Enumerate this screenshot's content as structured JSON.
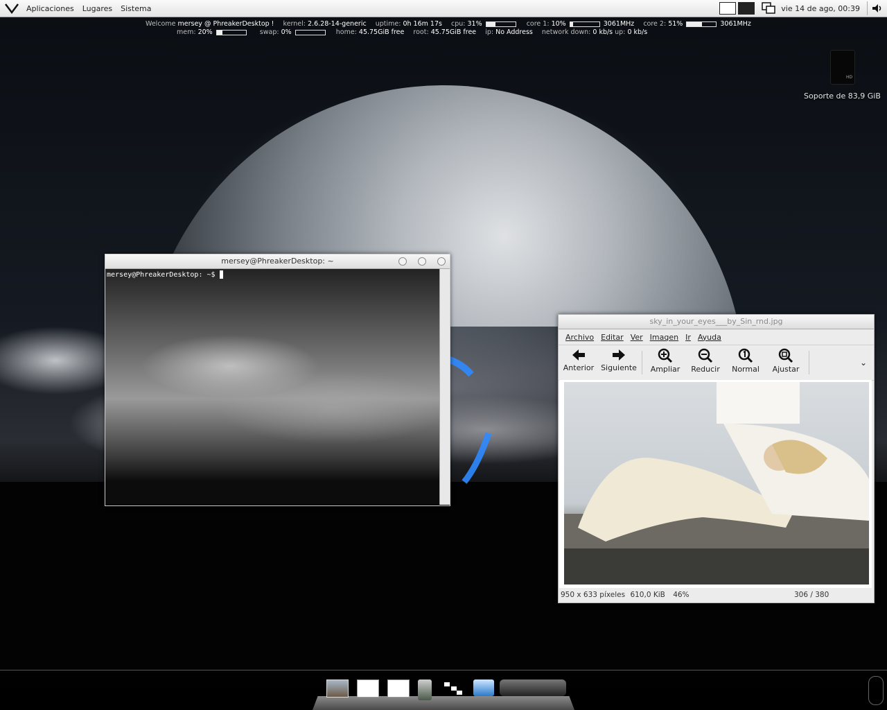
{
  "top_panel": {
    "menus": [
      "Aplicaciones",
      "Lugares",
      "Sistema"
    ],
    "clock": "vie 14 de ago, 00:39"
  },
  "conky": {
    "welcome_prefix": "Welcome",
    "user_host": "mersey @ PhreakerDesktop !",
    "kernel_label": "kernel:",
    "kernel": "2.6.28-14-generic",
    "uptime_label": "uptime:",
    "uptime": "0h 16m 17s",
    "cpu_label": "cpu:",
    "cpu": "31%",
    "core1_label": "core 1:",
    "core1": "10%",
    "core1_freq": "3061MHz",
    "core2_label": "core 2:",
    "core2": "51%",
    "core2_freq": "3061MHz",
    "mem_label": "mem:",
    "mem": "20%",
    "swap_label": "swap:",
    "swap": "0%",
    "home_label": "home:",
    "home": "45.75GiB free",
    "root_label": "root:",
    "root": "45.75GiB free",
    "ip_label": "ip:",
    "ip": "No Address",
    "net_down_label": "network down:",
    "net_down": "0 kb/s",
    "net_up_label": "up:",
    "net_up": "0 kb/s",
    "cpu_level": 0.31,
    "core1_level": 0.1,
    "core2_level": 0.51,
    "mem_level": 0.2,
    "swap_level": 0.0
  },
  "desktop": {
    "drive_icon_text": "HD",
    "drive_label": "Soporte de 83,9 GiB"
  },
  "terminal": {
    "title": "mersey@PhreakerDesktop: ~",
    "prompt": "mersey@PhreakerDesktop: ~$"
  },
  "viewer": {
    "title": "sky_in_your_eyes___by_Sin_rnd.jpg",
    "menus": [
      "Archivo",
      "Editar",
      "Ver",
      "Imagen",
      "Ir",
      "Ayuda"
    ],
    "tools": [
      "Anterior",
      "Siguiente",
      "Ampliar",
      "Reducir",
      "Normal",
      "Ajustar"
    ],
    "status_size": "950 x 633 píxeles",
    "status_filesize": "610,0 KiB",
    "status_zoom": "46%",
    "status_index": "306 / 380"
  }
}
